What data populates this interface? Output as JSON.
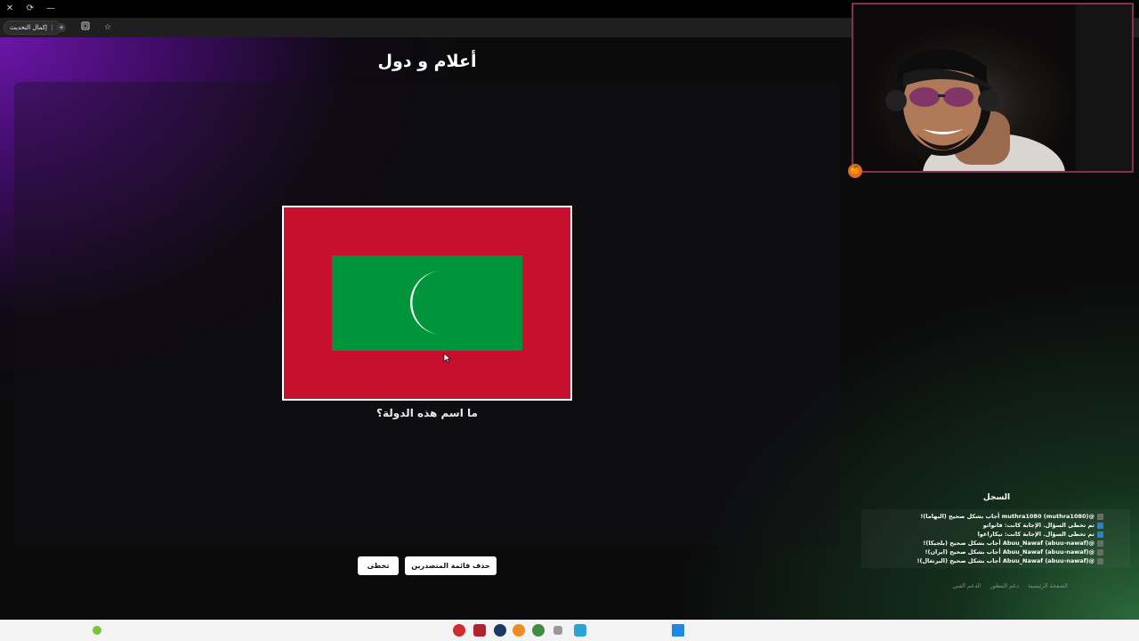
{
  "window_controls": {
    "close": "✕",
    "restore": "⟳",
    "minimize": "—"
  },
  "toolbar": {
    "update_label": "إكمال التحديث",
    "icons": [
      "menu-dots-icon",
      "extension-icon",
      "share-icon",
      "bookmark-star-icon"
    ]
  },
  "game": {
    "title": "أعلام و دول",
    "question": "ما اسم هذه الدولة؟",
    "flag": {
      "field_color": "#c8102e",
      "center_color": "#00953a",
      "crescent_color": "#ffffff"
    },
    "buttons": {
      "skip": "تخطى",
      "clear_leaderboard": "حذف قائمة المتصدرين"
    }
  },
  "log": {
    "title": "السجل",
    "entries": [
      {
        "type": "correct",
        "text": "@muthra1080 (muthra1080) أجاب بشكل صحيح (البهاما)!"
      },
      {
        "type": "skip",
        "text": "تم تخطى السؤال. الإجابة كانت: فانواتو"
      },
      {
        "type": "skip",
        "text": "تم تخطى السؤال. الإجابة كانت: نيكاراغوا"
      },
      {
        "type": "correct",
        "text": "@Abuu_Nawaf (abuu-nawaf) أجاب بشكل صحيح (بلجيكا)!"
      },
      {
        "type": "correct",
        "text": "@Abuu_Nawaf (abuu-nawaf) أجاب بشكل صحيح (ايران)!"
      },
      {
        "type": "correct",
        "text": "@Abuu_Nawaf (abuu-nawaf) أجاب بشكل صحيح (البرتغال)!"
      }
    ]
  },
  "footer": {
    "home": "الصفحة الرئيسية",
    "dev_support": "دعم المطور",
    "tech_support": "الدعم الفني"
  },
  "taskbar": {
    "icons": [
      "app-red-icon",
      "app-video-icon",
      "steam-icon",
      "obs-icon",
      "chrome-icon",
      "app-window-icon",
      "app-bird-icon",
      "windows-start-icon"
    ]
  }
}
